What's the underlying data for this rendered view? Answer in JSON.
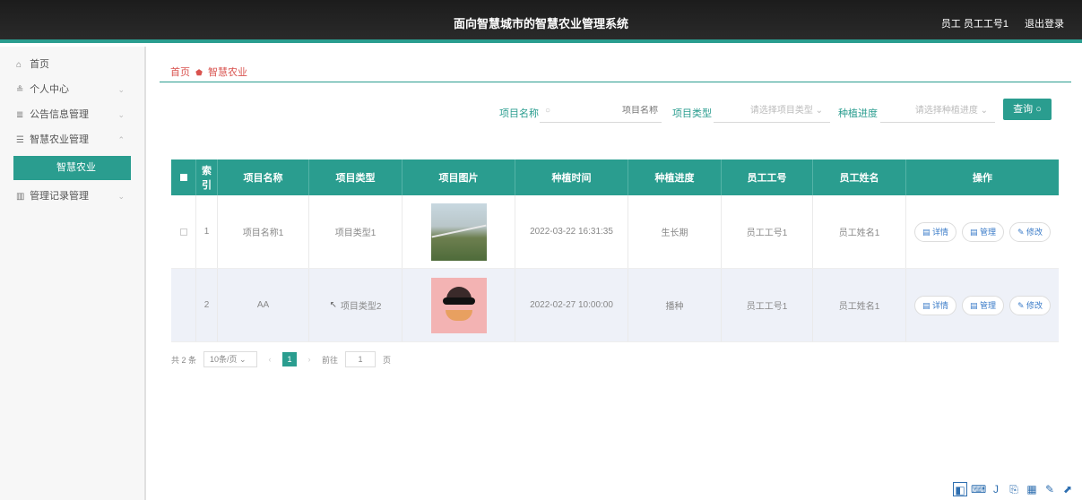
{
  "header": {
    "title": "面向智慧城市的智慧农业管理系统",
    "user": "员工 员工工号1",
    "logout": "退出登录"
  },
  "sidebar": {
    "items": [
      {
        "icon": "home-icon",
        "label": "首页"
      },
      {
        "icon": "user-icon",
        "label": "个人中心"
      },
      {
        "icon": "notice-icon",
        "label": "公告信息管理"
      },
      {
        "icon": "list-icon",
        "label": "智慧农业管理"
      },
      {
        "icon": "chart-icon",
        "label": "管理记录管理"
      }
    ],
    "sub_active": "智慧农业"
  },
  "breadcrumb": {
    "home": "首页",
    "current": "智慧农业"
  },
  "search": {
    "name_label": "项目名称",
    "name_placeholder": "项目名称",
    "type_label": "项目类型",
    "type_placeholder": "请选择项目类型",
    "progress_label": "种植进度",
    "progress_placeholder": "请选择种植进度",
    "button": "查询"
  },
  "table": {
    "headers": [
      "索引",
      "项目名称",
      "项目类型",
      "项目图片",
      "种植时间",
      "种植进度",
      "员工工号",
      "员工姓名",
      "操作"
    ],
    "rows": [
      {
        "index": "1",
        "name": "项目名称1",
        "type": "项目类型1",
        "time": "2022-03-22 16:31:35",
        "progress": "生长期",
        "emp_no": "员工工号1",
        "emp_name": "员工姓名1"
      },
      {
        "index": "2",
        "name": "AA",
        "type": "项目类型2",
        "time": "2022-02-27 10:00:00",
        "progress": "播种",
        "emp_no": "员工工号1",
        "emp_name": "员工姓名1"
      }
    ],
    "actions": [
      "详情",
      "管理",
      "修改"
    ]
  },
  "pager": {
    "total": "共 2 条",
    "size": "10条/页",
    "current": "1",
    "goto": "前往",
    "page_value": "1",
    "page_unit": "页"
  },
  "colors": {
    "accent": "#2a9d8f",
    "header_bg": "#1c1c1c"
  }
}
